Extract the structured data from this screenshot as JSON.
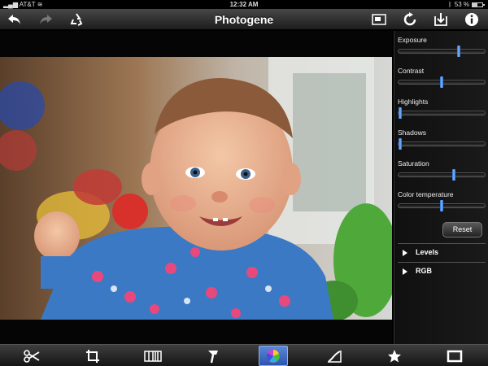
{
  "status_bar": {
    "carrier": "AT&T",
    "time": "12:32 AM",
    "battery": "53 %",
    "battery_level": 0.53
  },
  "app": {
    "title": "Photogene"
  },
  "top_toolbar": {
    "left": [
      "undo-icon",
      "redo-icon",
      "recycle-icon"
    ],
    "right": [
      "image-preview-icon",
      "refresh-icon",
      "save-icon",
      "info-icon"
    ]
  },
  "adjustments": [
    {
      "label": "Exposure",
      "value": 0.7
    },
    {
      "label": "Contrast",
      "value": 0.5
    },
    {
      "label": "Highlights",
      "value": 0.0
    },
    {
      "label": "Shadows",
      "value": 0.0
    },
    {
      "label": "Saturation",
      "value": 0.64
    },
    {
      "label": "Color temperature",
      "value": 0.5
    }
  ],
  "reset_label": "Reset",
  "sections": [
    {
      "label": "Levels"
    },
    {
      "label": "RGB"
    }
  ],
  "bottom_toolbar": {
    "tools": [
      "scissors-icon",
      "rotate-crop-icon",
      "filmstrip-icon",
      "brush-icon",
      "color-wheel-icon",
      "curves-icon",
      "star-icon",
      "frame-icon"
    ],
    "active_tool": "color-wheel-icon"
  },
  "colors": {
    "accent": "#3d6fcf",
    "toolbar": "#2a2a2a",
    "panel": "#141414"
  }
}
